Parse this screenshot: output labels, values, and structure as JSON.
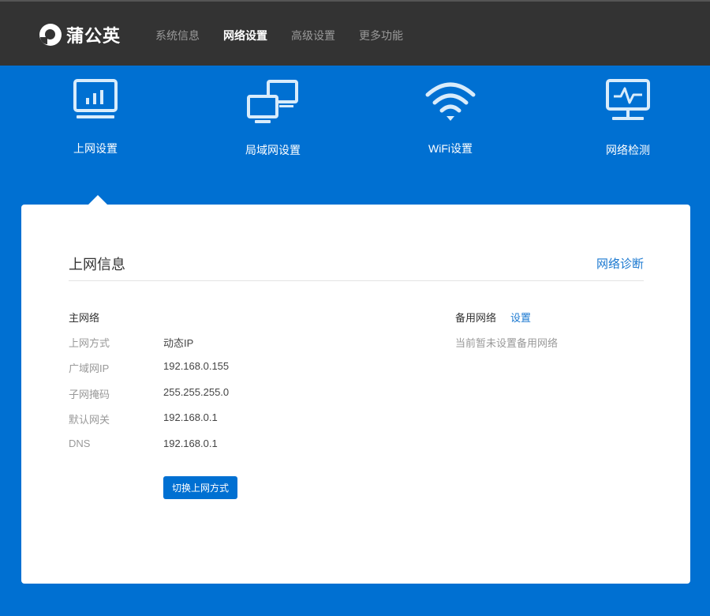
{
  "brand": {
    "name": "蒲公英",
    "logo_icon": "dandelion-logo-icon"
  },
  "topnav": {
    "items": [
      {
        "label": "系统信息",
        "active": false
      },
      {
        "label": "网络设置",
        "active": true
      },
      {
        "label": "高级设置",
        "active": false
      },
      {
        "label": "更多功能",
        "active": false
      }
    ]
  },
  "tiles": [
    {
      "label": "上网设置",
      "icon": "monitor-chart-icon",
      "active": true
    },
    {
      "label": "局域网设置",
      "icon": "lan-computers-icon",
      "active": false
    },
    {
      "label": "WiFi设置",
      "icon": "wifi-icon",
      "active": false
    },
    {
      "label": "网络检测",
      "icon": "network-monitor-icon",
      "active": false
    }
  ],
  "card": {
    "title": "上网信息",
    "diagnose_link": "网络诊断",
    "primary": {
      "title": "主网络",
      "rows": [
        {
          "key": "上网方式",
          "value": "动态IP"
        },
        {
          "key": "广域网IP",
          "value": "192.168.0.155"
        },
        {
          "key": "子网掩码",
          "value": "255.255.255.0"
        },
        {
          "key": "默认网关",
          "value": "192.168.0.1"
        },
        {
          "key": "DNS",
          "value": "192.168.0.1"
        }
      ],
      "switch_button": "切换上网方式"
    },
    "backup": {
      "title": "备用网络",
      "set_link": "设置",
      "note": "当前暂未设置备用网络"
    }
  },
  "colors": {
    "header": "#333333",
    "accent": "#0070d2",
    "link": "#1a78d0"
  }
}
